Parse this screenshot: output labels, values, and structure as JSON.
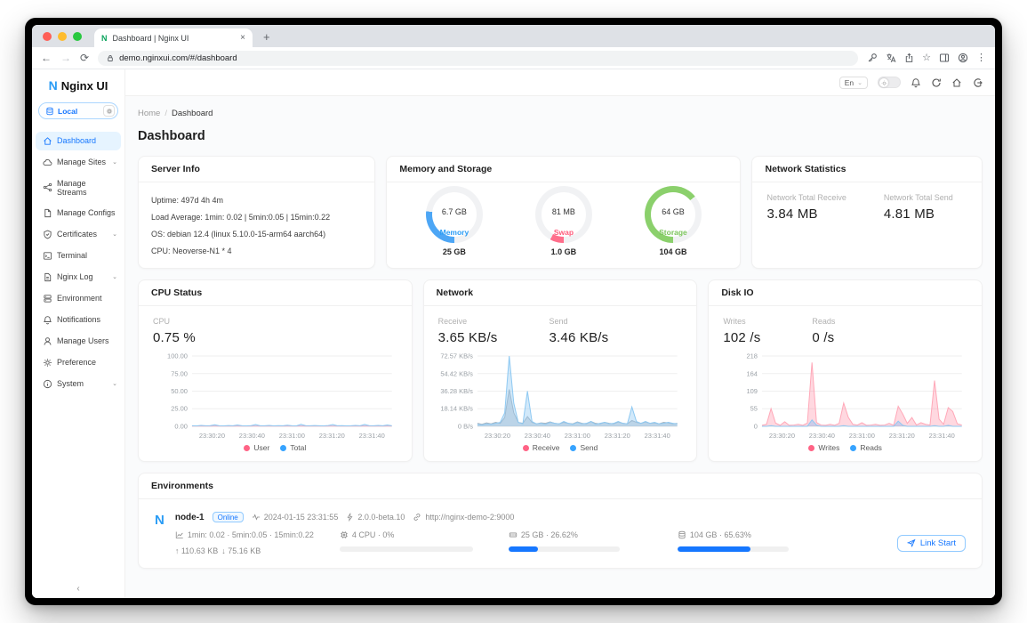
{
  "browser": {
    "tab_title": "Dashboard | Nginx UI",
    "tab_close": "×",
    "new_tab": "+",
    "favicon_letter": "N",
    "url": "demo.nginxui.com/#/dashboard"
  },
  "topbar": {
    "lang": "En"
  },
  "sidebar": {
    "logo_letter": "N",
    "logo_text": "Nginx UI",
    "env_label": "Local",
    "items": [
      {
        "label": "Dashboard"
      },
      {
        "label": "Manage Sites"
      },
      {
        "label": "Manage Streams"
      },
      {
        "label": "Manage Configs"
      },
      {
        "label": "Certificates"
      },
      {
        "label": "Terminal"
      },
      {
        "label": "Nginx Log"
      },
      {
        "label": "Environment"
      },
      {
        "label": "Notifications"
      },
      {
        "label": "Manage Users"
      },
      {
        "label": "Preference"
      },
      {
        "label": "System"
      }
    ],
    "collapse": "‹"
  },
  "breadcrumb": {
    "home": "Home",
    "sep": "/",
    "current": "Dashboard"
  },
  "page_title": "Dashboard",
  "server_info": {
    "title": "Server Info",
    "lines": [
      "Uptime: 497d 4h 4m",
      "Load Average: 1min: 0.02 | 5min:0.05 | 15min:0.22",
      "OS: debian 12.4 (linux 5.10.0-15-arm64 aarch64)",
      "CPU: Neoverse-N1 * 4"
    ]
  },
  "memory_storage": {
    "title": "Memory and Storage",
    "donuts": [
      {
        "value": "6.7 GB",
        "label": "Memory",
        "total": "25 GB",
        "pct": 26.8,
        "color": "#4da6f5"
      },
      {
        "value": "81 MB",
        "label": "Swap",
        "total": "1.0 GB",
        "pct": 7.9,
        "color": "#ff6e8b"
      },
      {
        "value": "64 GB",
        "label": "Storage",
        "total": "104 GB",
        "pct": 64.0,
        "color": "#8bd06c"
      }
    ]
  },
  "network_stats": {
    "title": "Network Statistics",
    "items": [
      {
        "label": "Network Total Receive",
        "value": "3.84 MB"
      },
      {
        "label": "Network Total Send",
        "value": "4.81 MB"
      }
    ]
  },
  "cpu_card": {
    "title": "CPU Status",
    "stats": [
      {
        "label": "CPU",
        "value": "0.75 %"
      }
    ]
  },
  "network_card": {
    "title": "Network",
    "stats": [
      {
        "label": "Receive",
        "value": "3.65 KB/s"
      },
      {
        "label": "Send",
        "value": "3.46 KB/s"
      }
    ]
  },
  "disk_card": {
    "title": "Disk IO",
    "stats": [
      {
        "label": "Writes",
        "value": "102 /s"
      },
      {
        "label": "Reads",
        "value": "0 /s"
      }
    ]
  },
  "chart_data": [
    {
      "type": "area",
      "title": "CPU Status",
      "ymax": 100,
      "yticks": [
        "100.00",
        "75.00",
        "50.00",
        "25.00",
        "0.00"
      ],
      "xticks": [
        "23:30:20",
        "23:30:40",
        "23:31:00",
        "23:31:20",
        "23:31:40"
      ],
      "legend": [
        {
          "name": "User",
          "color": "#ff6385"
        },
        {
          "name": "Total",
          "color": "#36a3ff"
        }
      ],
      "series": [
        {
          "name": "User",
          "line": "#ffb3c0",
          "fill": "rgba(255,99,133,0.15)",
          "values": [
            0.3,
            0.2,
            0.4,
            0.3,
            0.2,
            0.3,
            0.4,
            0.2,
            0.3,
            0.3,
            0.2,
            0.4,
            0.3,
            0.2,
            0.3,
            0.4,
            0.3,
            0.2,
            0.3,
            0.2,
            0.4,
            0.3,
            0.2,
            0.3,
            0.4,
            0.2,
            0.3,
            0.3,
            0.2,
            0.4,
            0.3,
            0.2,
            0.3,
            0.4,
            0.3,
            0.2,
            0.3,
            0.2,
            0.4,
            0.3,
            0.2,
            0.3,
            0.4,
            0.3,
            0.3
          ]
        },
        {
          "name": "Total",
          "line": "#8ec9f2",
          "fill": "rgba(54,163,255,0.20)",
          "values": [
            0.8,
            0.6,
            1.2,
            0.7,
            0.9,
            2.2,
            0.8,
            0.6,
            1.0,
            0.7,
            1.8,
            0.8,
            0.6,
            0.9,
            2.5,
            0.7,
            0.8,
            1.2,
            0.6,
            0.9,
            0.7,
            1.5,
            0.8,
            0.6,
            2.8,
            0.9,
            0.7,
            1.0,
            0.8,
            0.6,
            1.2,
            2.4,
            0.7,
            0.9,
            0.6,
            0.8,
            1.1,
            0.7,
            2.6,
            0.9,
            0.7,
            1.3,
            0.8,
            1.9,
            0.75
          ]
        }
      ]
    },
    {
      "type": "area",
      "title": "Network",
      "ymax": 72.57,
      "yticks": [
        "72.57 KB/s",
        "54.42 KB/s",
        "36.28 KB/s",
        "18.14 KB/s",
        "0 B/s"
      ],
      "xticks": [
        "23:30:20",
        "23:30:40",
        "23:31:00",
        "23:31:20",
        "23:31:40"
      ],
      "legend": [
        {
          "name": "Receive",
          "color": "#ff6385"
        },
        {
          "name": "Send",
          "color": "#36a3ff"
        }
      ],
      "series": [
        {
          "name": "Receive",
          "line": "#aab4be",
          "fill": "rgba(170,180,190,0.45)",
          "values": [
            3,
            2,
            3.5,
            2.5,
            4,
            3,
            9,
            38,
            14,
            4,
            3,
            10,
            4,
            2.5,
            3.5,
            3,
            4.5,
            3,
            2.5,
            4,
            3,
            2.5,
            4.5,
            3,
            2.5,
            5,
            3,
            2.5,
            4,
            3,
            2.5,
            4.5,
            3,
            2.5,
            6,
            4,
            3,
            4.5,
            3,
            3.5,
            2.5,
            4,
            3.5,
            2.5,
            3
          ]
        },
        {
          "name": "Send",
          "line": "#8ec9f2",
          "fill": "rgba(142,201,242,0.40)",
          "values": [
            2,
            1.5,
            2.5,
            2,
            3,
            4,
            14,
            72.57,
            24,
            4,
            2.5,
            36.3,
            5,
            2.5,
            3,
            2,
            4,
            3,
            2.5,
            5,
            3,
            2,
            4,
            2.5,
            3,
            5,
            2,
            3,
            4,
            2.5,
            3,
            5,
            3,
            2.5,
            20,
            5,
            3,
            5,
            3,
            4,
            2.5,
            3,
            4,
            3,
            2.5
          ]
        }
      ]
    },
    {
      "type": "area",
      "title": "Disk IO",
      "ymax": 218,
      "yticks": [
        "218",
        "164",
        "109",
        "55",
        "0"
      ],
      "xticks": [
        "23:30:20",
        "23:30:40",
        "23:31:00",
        "23:31:20",
        "23:31:40"
      ],
      "legend": [
        {
          "name": "Writes",
          "color": "#ff6385"
        },
        {
          "name": "Reads",
          "color": "#36a3ff"
        }
      ],
      "series": [
        {
          "name": "Writes",
          "line": "#ffa8b8",
          "fill": "rgba(255,99,133,0.25)",
          "values": [
            3,
            6,
            55,
            10,
            3,
            14,
            3,
            4,
            6,
            3,
            10,
            198,
            12,
            4,
            3,
            6,
            3,
            9,
            72,
            28,
            6,
            4,
            11,
            3,
            4,
            6,
            3,
            4,
            9,
            3,
            62,
            38,
            9,
            27,
            4,
            11,
            6,
            4,
            142,
            22,
            6,
            58,
            46,
            8,
            4
          ]
        },
        {
          "name": "Reads",
          "line": "#8ec9f2",
          "fill": "rgba(54,163,255,0.25)",
          "values": [
            0,
            0,
            2,
            0,
            0,
            0,
            0,
            0,
            0,
            0,
            0,
            20,
            4,
            0,
            0,
            0,
            0,
            0,
            2,
            0,
            0,
            0,
            0,
            0,
            0,
            0,
            0,
            0,
            0,
            0,
            16,
            3,
            0,
            0,
            0,
            0,
            0,
            0,
            2,
            0,
            0,
            3,
            0,
            0,
            0
          ]
        }
      ]
    }
  ],
  "environments": {
    "title": "Environments",
    "node": {
      "avatar": "N",
      "name": "node-1",
      "status": "Online",
      "timestamp": "2024-01-15 23:31:55",
      "version": "2.0.0-beta.10",
      "url": "http://nginx-demo-2:9000",
      "load": "1min: 0.02 · 5min:0.05 · 15min:0.22",
      "net_up": "↑ 110.63 KB",
      "net_down": "↓ 75.16 KB",
      "cpu": {
        "label": "4 CPU · 0%",
        "pct": 0
      },
      "memory": {
        "label": "25 GB · 26.62%",
        "pct": 26.62
      },
      "disk": {
        "label": "104 GB · 65.63%",
        "pct": 65.63
      },
      "button_label": "Link Start"
    }
  }
}
